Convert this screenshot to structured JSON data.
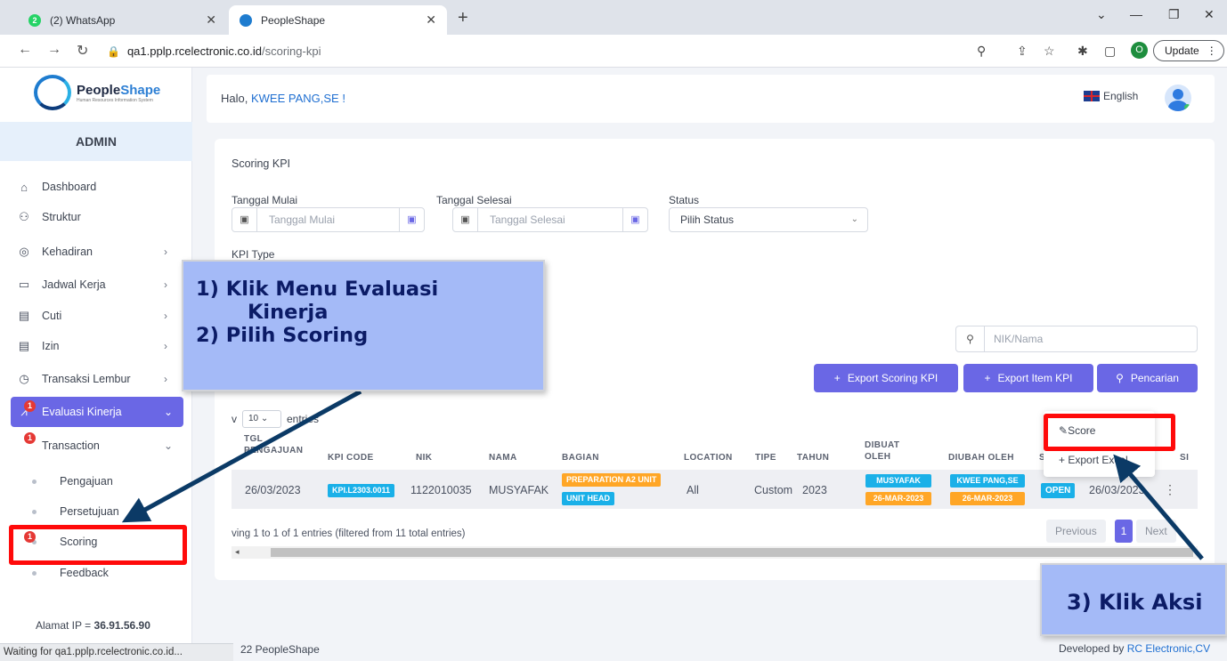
{
  "browser": {
    "tabs": [
      {
        "label": "(2) WhatsApp",
        "badge": "2"
      },
      {
        "label": "PeopleShape"
      }
    ],
    "url_host": "qa1.pplp.rcelectronic.co.id",
    "url_path": "/scoring-kpi",
    "profile_initial": "O",
    "update_label": "Update",
    "status_text": "Waiting for qa1.pplp.rcelectronic.co.id..."
  },
  "sidebar": {
    "logo_brand_a": "People",
    "logo_brand_b": "Shape",
    "logo_tagline": "Human Resources Information System",
    "role": "ADMIN",
    "items": [
      {
        "label": "Dashboard",
        "icon": "home-icon"
      },
      {
        "label": "Struktur",
        "icon": "sitemap-icon"
      },
      {
        "label": "Kehadiran",
        "icon": "fingerprint-icon",
        "chevron": true
      },
      {
        "label": "Jadwal Kerja",
        "icon": "briefcase-icon",
        "chevron": true
      },
      {
        "label": "Cuti",
        "icon": "calendar-icon",
        "chevron": true
      },
      {
        "label": "Izin",
        "icon": "calendar-icon",
        "chevron": true
      },
      {
        "label": "Transaksi Lembur",
        "icon": "clock-icon",
        "chevron": true
      },
      {
        "label": "Evaluasi Kinerja",
        "icon": "chart-icon",
        "chevron": true,
        "active": true
      }
    ],
    "transaction_label": "Transaction",
    "sub_items": [
      "Pengajuan",
      "Persetujuan",
      "Scoring",
      "Feedback"
    ],
    "badge_count": "1",
    "ip_label": "Alamat IP",
    "ip_sep": "=",
    "ip_value": "36.91.56.90"
  },
  "header": {
    "greeting": "Halo,",
    "user": "KWEE PANG,SE !",
    "language": "English"
  },
  "page": {
    "title": "Scoring KPI",
    "filters": {
      "start_label": "Tanggal Mulai",
      "start_placeholder": "Tanggal Mulai",
      "end_label": "Tanggal Selesai",
      "end_placeholder": "Tanggal Selesai",
      "status_label": "Status",
      "status_value": "Pilih Status",
      "kpi_type_label": "KPI Type"
    },
    "search_placeholder": "NIK/Nama",
    "buttons": {
      "export_scoring": "Export Scoring KPI",
      "export_item": "Export Item KPI",
      "search": "Pencarian"
    },
    "length": {
      "prefix": "v",
      "value": "10",
      "suffix": "entries"
    },
    "columns": {
      "tgl_a": "TGL",
      "tgl_b": "PENGAJUAN",
      "kpi_code": "KPI CODE",
      "nik": "NIK",
      "nama": "NAMA",
      "bagian": "BAGIAN",
      "location": "LOCATION",
      "tipe": "TIPE",
      "tahun": "TAHUN",
      "dibuat_a": "DIBUAT",
      "dibuat_b": "OLEH",
      "diubah": "DIUBAH OLEH",
      "status_fragment": "S",
      "aksi_fragment": "SI"
    },
    "row": {
      "tgl": "26/03/2023",
      "kpi_code": "KPI.L2303.0011",
      "nik": "1122010035",
      "nama": "MUSYAFAK",
      "bagian_1": "PREPARATION A2 UNIT",
      "bagian_2": "UNIT HEAD",
      "location": "All",
      "tipe": "Custom",
      "tahun": "2023",
      "dibuat_name": "MUSYAFAK",
      "dibuat_date": "26-MAR-2023",
      "diubah_name": "KWEE PANG,SE",
      "diubah_date": "26-MAR-2023",
      "status": "OPEN",
      "date2": "26/03/2023"
    },
    "info": "ving 1 to 1 of 1 entries (filtered from 11 total entries)",
    "pagination": {
      "prev": "Previous",
      "current": "1",
      "next": "Next"
    },
    "dropdown": {
      "score": "Score",
      "export": "+ Export Excel"
    }
  },
  "footer": {
    "copyright": "22 PeopleShape",
    "developed_prefix": "Developed by",
    "developed_by": "RC Electronic,CV"
  },
  "annotations": {
    "step1": "1) Klik Menu Evaluasi",
    "step1b": "Kinerja",
    "step2": "2) Pilih Scoring",
    "step3": "3) Klik Aksi"
  },
  "colors": {
    "accent": "#6a67e5",
    "annotation_red": "#ff0a0a",
    "callout_bg": "#a4baf7",
    "callout_text": "#0b1b66"
  }
}
